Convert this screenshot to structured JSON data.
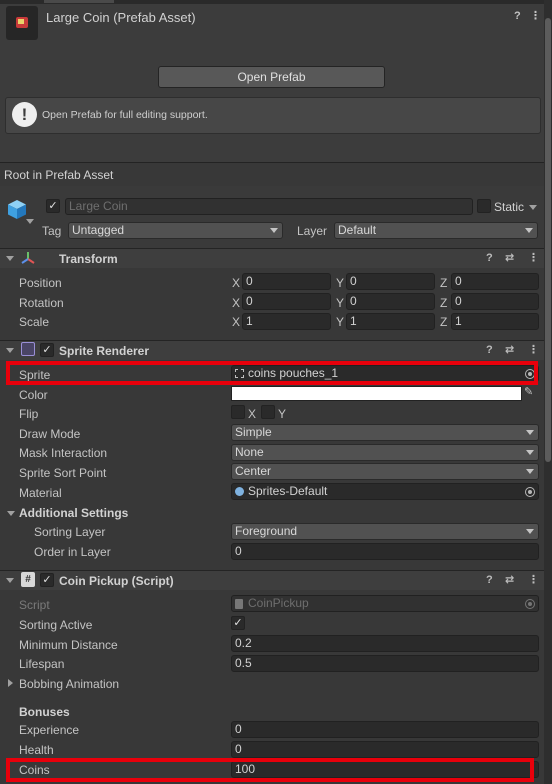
{
  "header": {
    "title": "Large Coin (Prefab Asset)",
    "help_icon_glyph": "?",
    "menu_icon_glyph": "⋮",
    "open_prefab_label": "Open Prefab",
    "help_text": "Open Prefab for full editing support.",
    "help_icon_glyph2": "!"
  },
  "root_label": "Root in Prefab Asset",
  "gameobject": {
    "name": "Large Coin",
    "static_label": "Static",
    "tag_label": "Tag",
    "tag_value": "Untagged",
    "layer_label": "Layer",
    "layer_value": "Default"
  },
  "transform": {
    "title": "Transform",
    "rows": [
      {
        "label": "Position",
        "x": "0",
        "y": "0",
        "z": "0"
      },
      {
        "label": "Rotation",
        "x": "0",
        "y": "0",
        "z": "0"
      },
      {
        "label": "Scale",
        "x": "1",
        "y": "1",
        "z": "1"
      }
    ],
    "axis_x": "X",
    "axis_y": "Y",
    "axis_z": "Z"
  },
  "sprite_renderer": {
    "title": "Sprite Renderer",
    "sprite_label": "Sprite",
    "sprite_value": "coins pouches_1",
    "color_label": "Color",
    "flip_label": "Flip",
    "flip_x": "X",
    "flip_y": "Y",
    "draw_mode_label": "Draw Mode",
    "draw_mode_value": "Simple",
    "mask_label": "Mask Interaction",
    "mask_value": "None",
    "sort_point_label": "Sprite Sort Point",
    "sort_point_value": "Center",
    "material_label": "Material",
    "material_value": "Sprites-Default",
    "additional_label": "Additional Settings",
    "sorting_layer_label": "Sorting Layer",
    "sorting_layer_value": "Foreground",
    "order_label": "Order in Layer",
    "order_value": "0"
  },
  "coin_pickup": {
    "title": "Coin Pickup (Script)",
    "script_label": "Script",
    "script_value": "CoinPickup",
    "sorting_active_label": "Sorting Active",
    "sorting_active_check": "✓",
    "min_distance_label": "Minimum Distance",
    "min_distance_value": "0.2",
    "lifespan_label": "Lifespan",
    "lifespan_value": "0.5",
    "bobbing_label": "Bobbing Animation",
    "bonuses_label": "Bonuses",
    "experience_label": "Experience",
    "experience_value": "0",
    "health_label": "Health",
    "health_value": "0",
    "coins_label": "Coins",
    "coins_value": "100"
  },
  "glyphs": {
    "check": "✓",
    "help": "?",
    "settings": "⇄",
    "menu": "⋮"
  },
  "colors": {
    "highlight": "#e8000b",
    "panel_bg": "#383838"
  }
}
